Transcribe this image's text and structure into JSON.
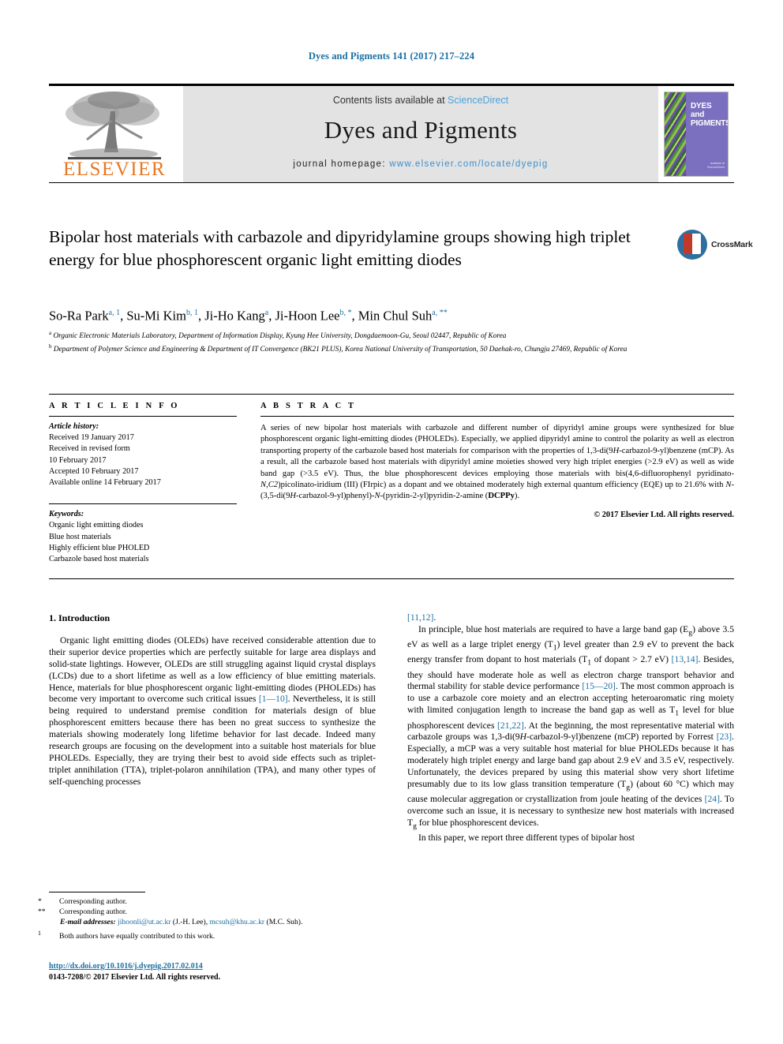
{
  "running_head": "Dyes and Pigments 141 (2017) 217–224",
  "masthead": {
    "publisher_name": "ELSEVIER",
    "contents_prefix": "Contents lists available at ",
    "contents_link": "ScienceDirect",
    "journal_title": "Dyes and Pigments",
    "homepage_prefix": "journal homepage: ",
    "homepage_url": "www.elsevier.com/locate/dyepig",
    "cover_title": "DYES and PIGMENTS",
    "cover_footer": "available at\nScienceDirect\nwww.sciencedirect.com"
  },
  "article": {
    "title": "Bipolar host materials with carbazole and dipyridylamine groups showing high triplet energy for blue phosphorescent organic light emitting diodes",
    "crossmark_label": "CrossMark",
    "authors": [
      {
        "name": "So-Ra Park",
        "marks": "a, 1",
        "sep": ", "
      },
      {
        "name": "Su-Mi Kim",
        "marks": "b, 1",
        "sep": ", "
      },
      {
        "name": "Ji-Ho Kang",
        "marks": "a",
        "sep": ", "
      },
      {
        "name": "Ji-Hoon Lee",
        "marks": "b, *",
        "sep": ", "
      },
      {
        "name": "Min Chul Suh",
        "marks": "a, **",
        "sep": ""
      }
    ],
    "affiliations": [
      {
        "mark": "a",
        "text": "Organic Electronic Materials Laboratory, Department of Information Display, Kyung Hee University, Dongdaemoon-Gu, Seoul 02447, Republic of Korea"
      },
      {
        "mark": "b",
        "text": "Department of Polymer Science and Engineering & Department of IT Convergence (BK21 PLUS), Korea National University of Transportation, 50 Daehak-ro, Chungju 27469, Republic of Korea"
      }
    ]
  },
  "article_info": {
    "heading": "A R T I C L E   I N F O",
    "history_label": "Article history:",
    "history": [
      "Received 19 January 2017",
      "Received in revised form",
      "10 February 2017",
      "Accepted 10 February 2017",
      "Available online 14 February 2017"
    ],
    "keywords_label": "Keywords:",
    "keywords": [
      "Organic light emitting diodes",
      "Blue host materials",
      "Highly efficient blue PHOLED",
      "Carbazole based host materials"
    ]
  },
  "abstract": {
    "heading": "A B S T R A C T",
    "part1": "A series of new bipolar host materials with carbazole and different number of dipyridyl amine groups were synthesized for blue phosphorescent organic light-emitting diodes (PHOLEDs). Especially, we applied dipyridyl amine to control the polarity as well as electron transporting property of the carbazole based host materials for comparison with the properties of 1,3-di(9",
    "it_9H_a": "H",
    "part2": "-carbazol-9-yl)benzene (mCP). As a result, all the carbazole based host materials with dipyridyl amine moieties showed very high triplet energies (>2.9 eV) as well as wide band gap (>3.5 eV). Thus, the blue phosphorescent devices employing those materials with bis(4,6-difluorophenyl pyridinato-",
    "it_N": "N",
    "part3": ",",
    "it_C2": "C2",
    "part4": ")picolinato-iridium (III) (FIrpic) as a dopant and we obtained moderately high external quantum efficiency (EQE) up to 21.6% with ",
    "it_N2": "N",
    "part5": "-(3,5-di(9",
    "it_9H_b": "H",
    "part6": "-carbazol-9-yl)phenyl)-",
    "it_N3": "N",
    "part7": "-(pyridin-2-yl)pyridin-2-amine (",
    "bold_DCPPy": "DCPPy",
    "part8": ").",
    "copyright": "© 2017 Elsevier Ltd. All rights reserved."
  },
  "body": {
    "section_heading": "1. Introduction",
    "left_paragraphs": [
      "Organic light emitting diodes (OLEDs) have received considerable attention due to their superior device properties which are perfectly suitable for large area displays and solid-state lightings. However, OLEDs are still struggling against liquid crystal displays (LCDs) due to a short lifetime as well as a low efficiency of blue emitting materials. Hence, materials for blue phosphorescent organic light-emitting diodes (PHOLEDs) has become very important to overcome such critical issues [1—10]. Nevertheless, it is still being required to understand premise condition for materials design of blue phosphorescent emitters because there has been no great success to synthesize the materials showing moderately long lifetime behavior for last decade. Indeed many research groups are focusing on the development into a suitable host materials for blue PHOLEDs. Especially, they are trying their best to avoid side effects such as triplet-triplet annihilation (TTA), triplet-polaron annihilation (TPA), and many other types of self-quenching processes"
    ],
    "right_first_line": "[11,12].",
    "right_paragraphs": [
      "In principle, blue host materials are required to have a large band gap (Eg) above 3.5 eV as well as a large triplet energy (T1) level greater than 2.9 eV to prevent the back energy transfer from dopant to host materials (T1 of dopant > 2.7 eV) [13,14]. Besides, they should have moderate hole as well as electron charge transport behavior and thermal stability for stable device performance [15—20]. The most common approach is to use a carbazole core moiety and an electron accepting heteroaromatic ring moiety with limited conjugation length to increase the band gap as well as T1 level for blue phosphorescent devices [21,22]. At the beginning, the most representative material with carbazole groups was 1,3-di(9H-carbazol-9-yl)benzene (mCP) reported by Forrest [23]. Especially, a mCP was a very suitable host material for blue PHOLEDs because it has moderately high triplet energy and large band gap about 2.9 eV and 3.5 eV, respectively. Unfortunately, the devices prepared by using this material show very short lifetime presumably due to its low glass transition temperature (Tg) (about 60 °C) which may cause molecular aggregation or crystallization from joule heating of the devices [24]. To overcome such an issue, it is necessary to synthesize new host materials with increased Tg for blue phosphorescent devices.",
      "In this paper, we report three different types of bipolar host"
    ]
  },
  "footnotes": {
    "corresponding_1_mark": "*",
    "corresponding_1": "Corresponding author.",
    "corresponding_2_mark": "**",
    "corresponding_2": "Corresponding author.",
    "email_label": "E-mail addresses:",
    "email_1": "jihoonli@ut.ac.kr",
    "email_1_owner": "(J.-H. Lee),",
    "email_2": "mcsuh@khu.ac.kr",
    "email_2_owner": "(M.C. Suh).",
    "equal_mark": "1",
    "equal_contrib": "Both authors have equally contributed to this work."
  },
  "footer": {
    "doi": "http://dx.doi.org/10.1016/j.dyepig.2017.02.014",
    "issn_line": "0143-7208/© 2017 Elsevier Ltd. All rights reserved."
  },
  "colors": {
    "link_blue": "#1a6fa3",
    "sciencedirect_blue": "#4da3d8",
    "elsevier_orange": "#e87722",
    "masthead_gray": "#e3e3e3",
    "crossmark_blue": "#2f6f9f",
    "crossmark_red": "#c0392b",
    "cover_purple": "#7b6fbf"
  }
}
